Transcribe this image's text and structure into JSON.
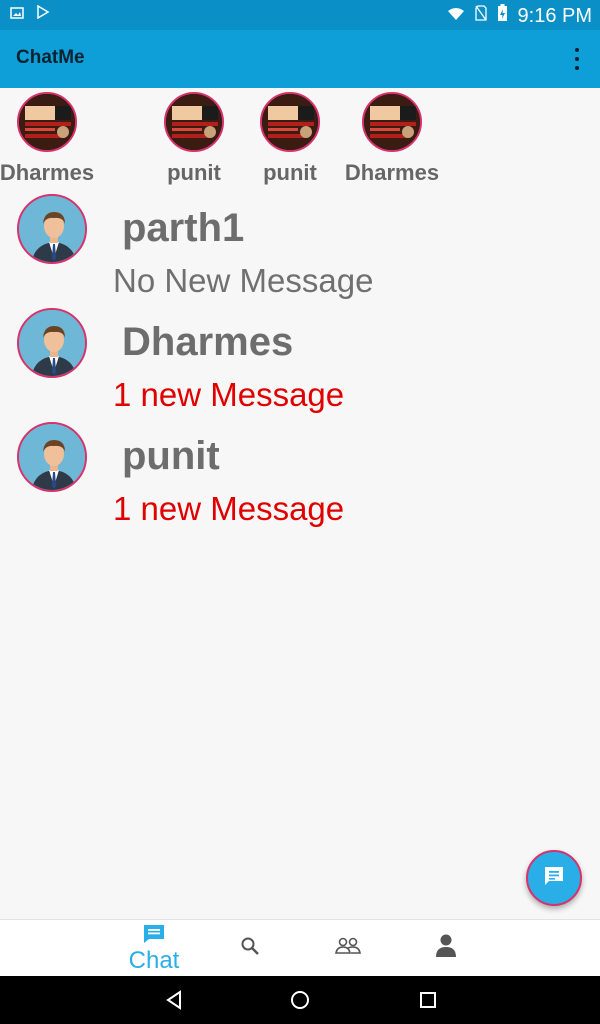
{
  "status_bar": {
    "time": "9:16 PM"
  },
  "app_bar": {
    "title": "ChatMe",
    "overflow_icon": "more-vert-icon"
  },
  "stories": [
    {
      "name": "Dharmes"
    },
    {
      "name": "punit"
    },
    {
      "name": "punit"
    },
    {
      "name": "Dharmes"
    }
  ],
  "chats": [
    {
      "name": "parth1",
      "status": "No New Message",
      "status_color": "#707070"
    },
    {
      "name": "Dharmes",
      "status": "1  new Message",
      "status_color": "#e00000"
    },
    {
      "name": "punit",
      "status": "1  new Message",
      "status_color": "#e00000"
    }
  ],
  "fab": {
    "icon": "new-message-icon"
  },
  "bottom_nav": {
    "chat_label": "Chat",
    "items": [
      "chat-icon",
      "search-icon",
      "people-icon",
      "profile-icon"
    ]
  },
  "colors": {
    "accent": "#0e9fd8",
    "fab": "#29aee8",
    "unread": "#e00000",
    "avatar_border": "#d7326b"
  }
}
